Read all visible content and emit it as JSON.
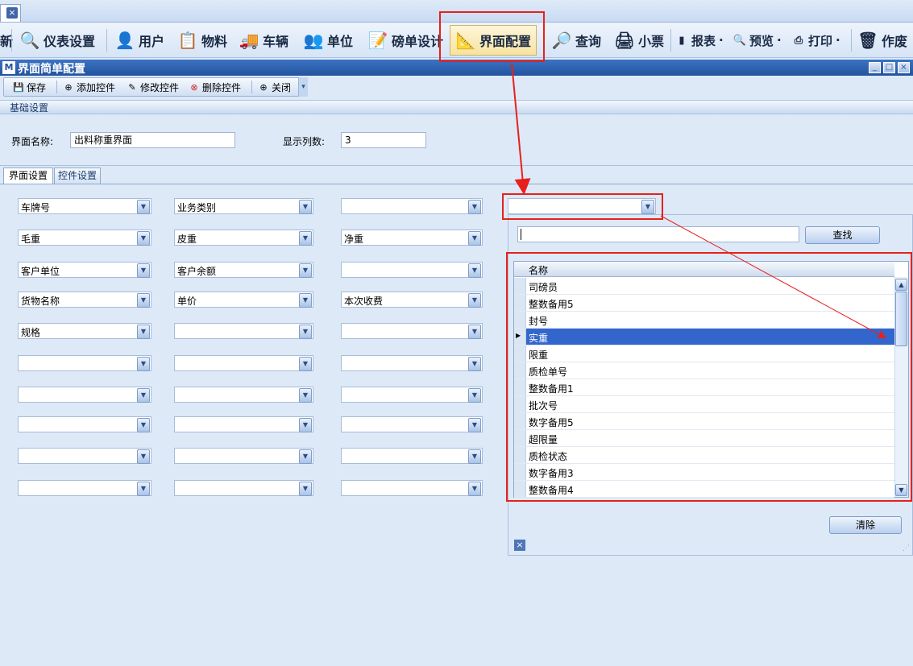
{
  "doc_tab": {
    "close_icon": "close-icon"
  },
  "ribbon": {
    "items": [
      {
        "label": "新",
        "icon": "partial-icon"
      },
      {
        "label": "仪表设置",
        "icon": "meter-settings-icon"
      },
      {
        "label": "用户",
        "icon": "user-icon"
      },
      {
        "label": "物料",
        "icon": "material-icon"
      },
      {
        "label": "车辆",
        "icon": "vehicle-icon"
      },
      {
        "label": "单位",
        "icon": "unit-icon"
      },
      {
        "label": "磅单设计",
        "icon": "ticket-design-icon"
      },
      {
        "label": "界面配置",
        "icon": "ui-config-icon"
      },
      {
        "label": "查询",
        "icon": "search-icon"
      },
      {
        "label": "小票",
        "icon": "printer-icon"
      },
      {
        "label": "报表",
        "icon": "report-icon"
      },
      {
        "label": "预览",
        "icon": "preview-icon"
      },
      {
        "label": "打印",
        "icon": "print-icon"
      },
      {
        "label": "作废",
        "icon": "trash-icon"
      }
    ],
    "dropdown_arrow": "·"
  },
  "window": {
    "logo": "M",
    "title": "界面简单配置",
    "min": "_",
    "max": "□",
    "close": "×"
  },
  "subtoolbar": {
    "save": "保存",
    "add": "添加控件",
    "edit": "修改控件",
    "delete": "删除控件",
    "close": "关闭"
  },
  "basic": {
    "group_title": "基础设置",
    "name_label": "界面名称:",
    "name_value": "出料称重界面",
    "cols_label": "显示列数:",
    "cols_value": "3"
  },
  "tabs": {
    "ui": "界面设置",
    "ctrl": "控件设置"
  },
  "grid_fields": [
    [
      "车牌号",
      "业务类别",
      ""
    ],
    [
      "毛重",
      "皮重",
      "净重"
    ],
    [
      "客户单位",
      "客户余额",
      ""
    ],
    [
      "货物名称",
      "单价",
      "本次收费"
    ],
    [
      "规格",
      "",
      ""
    ],
    [
      "",
      "",
      ""
    ],
    [
      "",
      "",
      ""
    ],
    [
      "",
      "",
      ""
    ],
    [
      "",
      "",
      ""
    ],
    [
      "",
      "",
      ""
    ]
  ],
  "popup": {
    "combo_value": "",
    "search_value": "",
    "search_button": "查找",
    "column_header": "名称",
    "rows": [
      "司磅员",
      "整数备用5",
      "封号",
      "实重",
      "限重",
      "质检单号",
      "整数备用1",
      "批次号",
      "数字备用5",
      "超限量",
      "质检状态",
      "数字备用3",
      "整数备用4"
    ],
    "selected_index": 3,
    "clear_button": "清除"
  },
  "colors": {
    "accent": "#3366cc",
    "highlight": "#e8201d",
    "title_bar": "#2c5fae"
  }
}
